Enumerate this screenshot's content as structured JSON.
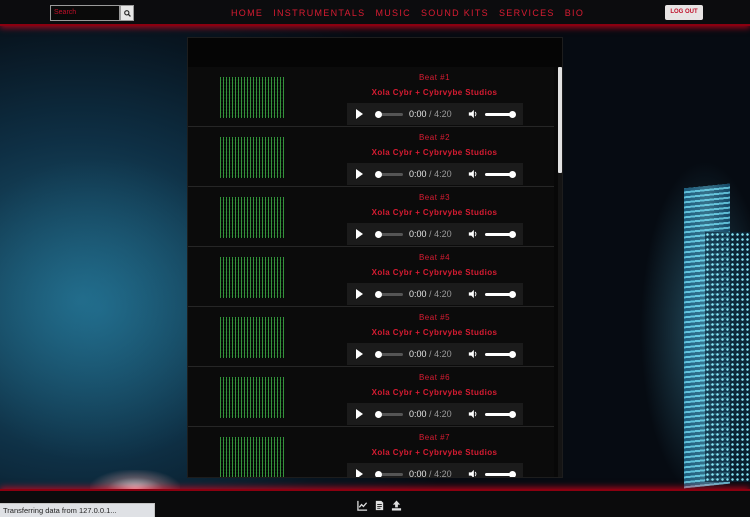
{
  "search": {
    "placeholder": "Search"
  },
  "nav": {
    "items": [
      "HOME",
      "INSTRUMENTALS",
      "MUSIC",
      "SOUND KITS",
      "SERVICES",
      "BIO"
    ],
    "logout_label": "LOG OUT"
  },
  "tracks": [
    {
      "title": "Beat #1",
      "artist": "Xola Cybr + Cybrvybe Studios",
      "current_time": "0:00",
      "duration": "4:20"
    },
    {
      "title": "Beat #2",
      "artist": "Xola Cybr + Cybrvybe Studios",
      "current_time": "0:00",
      "duration": "4:20"
    },
    {
      "title": "Beat #3",
      "artist": "Xola Cybr + Cybrvybe Studios",
      "current_time": "0:00",
      "duration": "4:20"
    },
    {
      "title": "Beat #4",
      "artist": "Xola Cybr + Cybrvybe Studios",
      "current_time": "0:00",
      "duration": "4:20"
    },
    {
      "title": "Beat #5",
      "artist": "Xola Cybr + Cybrvybe Studios",
      "current_time": "0:00",
      "duration": "4:20"
    },
    {
      "title": "Beat #6",
      "artist": "Xola Cybr + Cybrvybe Studios",
      "current_time": "0:00",
      "duration": "4:20"
    },
    {
      "title": "Beat #7",
      "artist": "Xola Cybr + Cybrvybe Studios",
      "current_time": "0:00",
      "duration": "4:20"
    }
  ],
  "player": {
    "volume": 1.0,
    "progress": 0.0
  },
  "toolbar_icons": [
    "chart-icon",
    "document-icon",
    "upload-icon"
  ],
  "status": {
    "text": "Transferring data from 127.0.0.1..."
  },
  "colors": {
    "accent": "#d81c32",
    "nav_border": "#8b0010"
  }
}
